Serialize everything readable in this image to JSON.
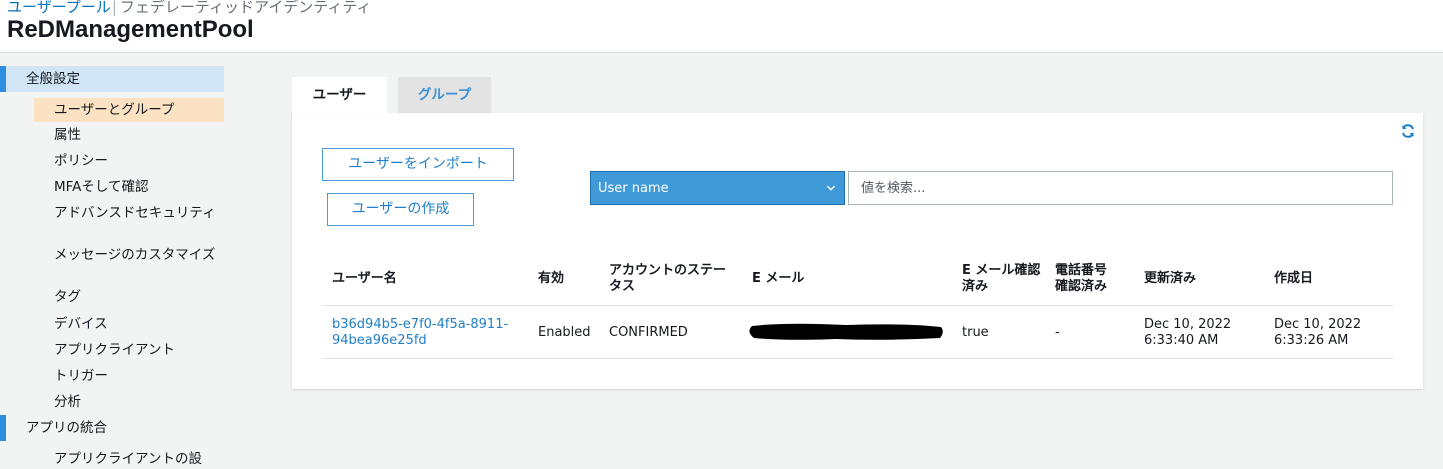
{
  "header": {
    "breadcrumb_link": "ユーザープール",
    "breadcrumb_separator": "|",
    "breadcrumb_next": "フェデレーティッドアイデンティティ",
    "pool_name": "ReDManagementPool"
  },
  "sidebar": {
    "section_general": "全般設定",
    "items": [
      "ユーザーとグループ",
      "属性",
      "ポリシー",
      "MFAそして確認",
      "アドバンスドセキュリティ",
      "メッセージのカスタマイズ",
      "タグ",
      "デバイス",
      "アプリクライアント",
      "トリガー",
      "分析"
    ],
    "section_integration": "アプリの統合",
    "integration_items": [
      "アプリクライアントの設"
    ]
  },
  "tabs": {
    "users": "ユーザー",
    "groups": "グループ"
  },
  "toolbar": {
    "import_label": "ユーザーをインポート",
    "create_label": "ユーザーの作成",
    "filter_selected": "User name",
    "search_placeholder": "値を検索..."
  },
  "table": {
    "columns": [
      "ユーザー名",
      "有効",
      "アカウントのステータス",
      "E メール",
      "E メール確認済み",
      "電話番号確認済み",
      "更新済み",
      "作成日"
    ],
    "rows": [
      {
        "username": "b36d94b5-e7f0-4f5a-8911-94bea96e25fd",
        "enabled": "Enabled",
        "status": "CONFIRMED",
        "email": "",
        "email_verified": "true",
        "phone_verified": "-",
        "updated": "Dec 10, 2022 6:33:40 AM",
        "created": "Dec 10, 2022 6:33:26 AM"
      }
    ]
  },
  "colors": {
    "accent": "#0073bb",
    "select_bg": "#409ad8",
    "selected_item_bg": "#fbe2c3",
    "section_active_bg": "#d0e6f6"
  },
  "icons": {
    "refresh": "refresh-icon",
    "chevron": "chevron-down-icon"
  }
}
